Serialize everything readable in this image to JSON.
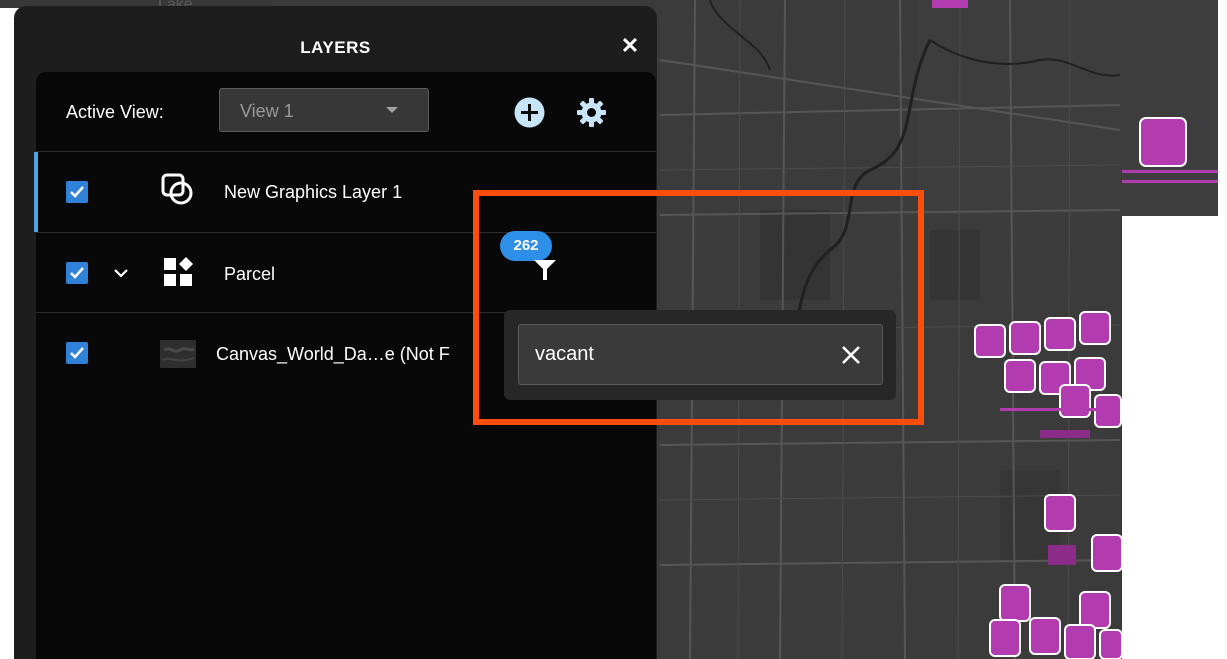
{
  "map": {
    "place_label": "Lake"
  },
  "panel": {
    "title": "LAYERS",
    "close_icon": "close-icon",
    "active_view_label": "Active View:",
    "view_selected": "View 1",
    "add_icon": "add-circle-icon",
    "settings_icon": "gear-icon"
  },
  "layers": [
    {
      "label": "New Graphics Layer 1",
      "checked": true,
      "icon": "graphics-layer-icon",
      "selected": true
    },
    {
      "label": "Parcel",
      "checked": true,
      "icon": "feature-layer-icon",
      "expandable": true
    },
    {
      "label": "Canvas_World_Da…e (Not F",
      "checked": true,
      "icon": "basemap-thumbnail"
    }
  ],
  "filter": {
    "count": "262",
    "icon": "filter-icon",
    "search_value": "vacant",
    "clear_icon": "clear-icon"
  },
  "colors": {
    "accent_blue": "#2f82d8",
    "badge_blue": "#2d8fe8",
    "highlight_orange": "#ff4d0e",
    "marker_magenta": "#b23bb0"
  }
}
